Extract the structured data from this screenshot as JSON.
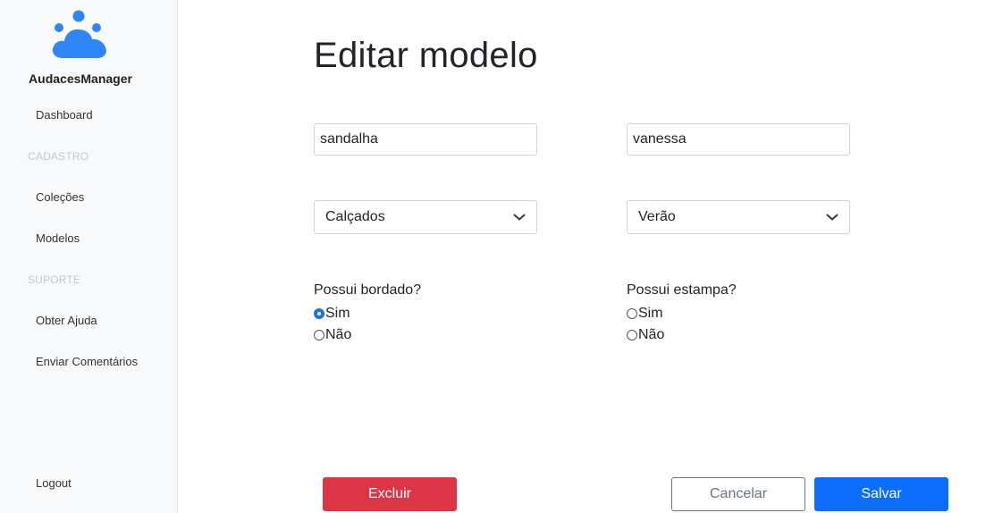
{
  "app": {
    "brand": "AudacesManager",
    "logo_icon": "cloud-people-icon",
    "accent_color": "#2f86f6"
  },
  "sidebar": {
    "dashboard": "Dashboard",
    "section_cadastro": "CADASTRO",
    "colecoes": "Coleções",
    "modelos": "Modelos",
    "section_suporte": "SUPORTE",
    "obter_ajuda": "Obter Ajuda",
    "enviar_comentarios": "Enviar Comentários",
    "logout": "Logout"
  },
  "page": {
    "title": "Editar modelo"
  },
  "form": {
    "nome_value": "sandalha",
    "responsavel_value": "vanessa",
    "tipo_selected": "Calçados",
    "colecao_selected": "Verão",
    "bordado": {
      "question": "Possui bordado?",
      "options": [
        "Sim",
        "Não"
      ],
      "selected": "Sim"
    },
    "estampa": {
      "question": "Possui estampa?",
      "options": [
        "Sim",
        "Não"
      ],
      "selected": ""
    }
  },
  "actions": {
    "delete_label": "Excluir",
    "cancel_label": "Cancelar",
    "save_label": "Salvar"
  }
}
